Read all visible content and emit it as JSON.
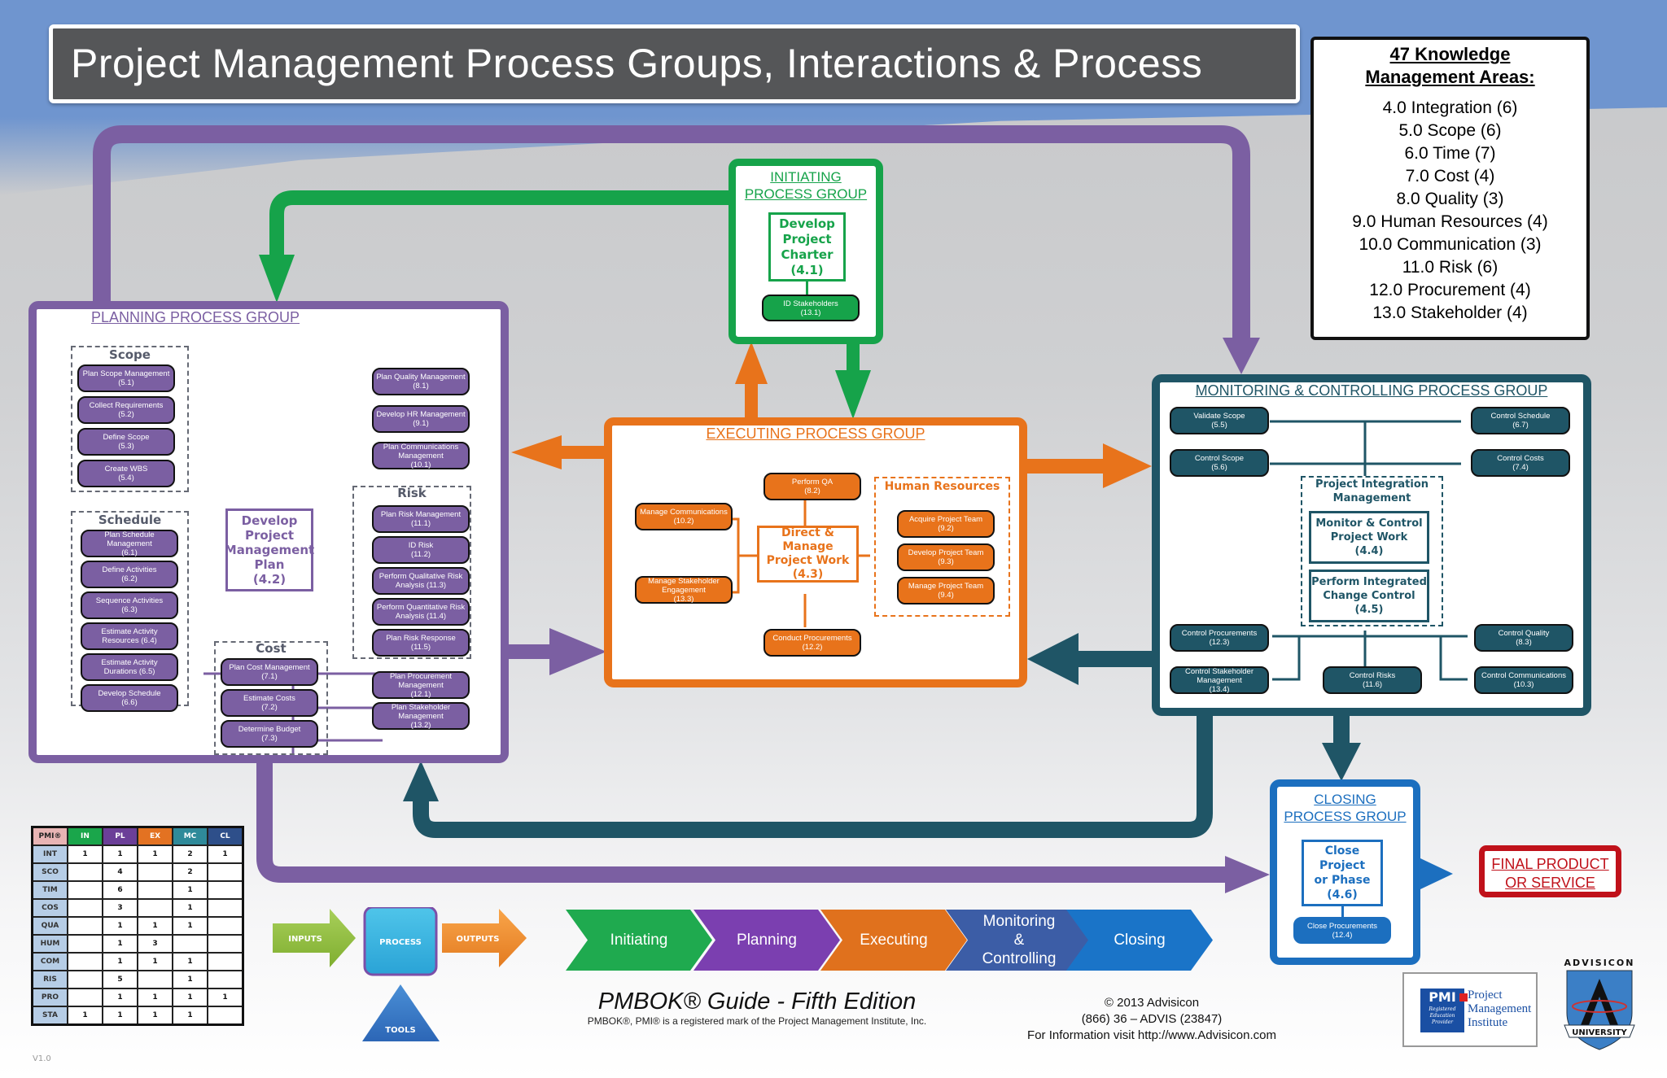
{
  "title": "Project Management Process Groups, Interactions & Process",
  "knowledge_areas": {
    "title_line1": "47 Knowledge",
    "title_line2": "Management Areas:",
    "items": [
      "4.0 Integration (6)",
      "5.0 Scope (6)",
      "6.0 Time (7)",
      "7.0 Cost (4)",
      "8.0 Quality (3)",
      "9.0 Human Resources (4)",
      "10.0 Communication (3)",
      "11.0 Risk (6)",
      "12.0 Procurement (4)",
      "13.0 Stakeholder (4)"
    ]
  },
  "colors": {
    "initiating": "#16a34a",
    "planning": "#7b5fa2",
    "executing": "#e8731b",
    "monitoring": "#1f5566",
    "closing": "#1c6fbf",
    "final": "#c0111a"
  },
  "initiating": {
    "heading_line1": "INITIATING",
    "heading_line2": "PROCESS GROUP",
    "core": "Develop\nProject\nCharter\n(4.1)",
    "processes": [
      {
        "name": "ID Stakeholders",
        "code": "(13.1)"
      }
    ]
  },
  "planning": {
    "heading": "PLANNING PROCESS GROUP",
    "core": "Develop\nProject\nManagement\nPlan\n(4.2)",
    "scope": {
      "label": "Scope",
      "processes": [
        {
          "name": "Plan Scope Management",
          "code": "(5.1)"
        },
        {
          "name": "Collect Requirements",
          "code": "(5.2)"
        },
        {
          "name": "Define Scope",
          "code": "(5.3)"
        },
        {
          "name": "Create WBS",
          "code": "(5.4)"
        }
      ]
    },
    "schedule": {
      "label": "Schedule",
      "processes": [
        {
          "name": "Plan Schedule Management",
          "code": "(6.1)"
        },
        {
          "name": "Define Activities",
          "code": "(6.2)"
        },
        {
          "name": "Sequence Activities",
          "code": "(6.3)"
        },
        {
          "name": "Estimate Activity Resources (6.4)",
          "code": ""
        },
        {
          "name": "Estimate Activity Durations (6.5)",
          "code": ""
        },
        {
          "name": "Develop Schedule",
          "code": "(6.6)"
        }
      ]
    },
    "cost": {
      "label": "Cost",
      "processes": [
        {
          "name": "Plan Cost Management",
          "code": "(7.1)"
        },
        {
          "name": "Estimate Costs",
          "code": "(7.2)"
        },
        {
          "name": "Determine Budget",
          "code": "(7.3)"
        }
      ]
    },
    "other": [
      {
        "name": "Plan Quality Management",
        "code": "(8.1)"
      },
      {
        "name": "Develop HR Management",
        "code": "(9.1)"
      },
      {
        "name": "Plan Communications Management",
        "code": "(10.1)"
      }
    ],
    "risk": {
      "label": "Risk",
      "processes": [
        {
          "name": "Plan Risk Management",
          "code": "(11.1)"
        },
        {
          "name": "ID Risk",
          "code": "(11.2)"
        },
        {
          "name": "Perform Qualitative Risk Analysis (11.3)",
          "code": ""
        },
        {
          "name": "Perform Quantitative Risk Analysis (11.4)",
          "code": ""
        },
        {
          "name": "Plan Risk Response",
          "code": "(11.5)"
        }
      ]
    },
    "procurement_stakeholder": [
      {
        "name": "Plan Procurement Management",
        "code": "(12.1)"
      },
      {
        "name": "Plan Stakeholder Management",
        "code": "(13.2)"
      }
    ]
  },
  "executing": {
    "heading": "EXECUTING PROCESS GROUP",
    "core": "Direct & Manage\nProject Work\n(4.3)",
    "top": {
      "name": "Perform QA",
      "code": "(8.2)"
    },
    "bottom": {
      "name": "Conduct Procurements",
      "code": "(12.2)"
    },
    "left": [
      {
        "name": "Manage Communications",
        "code": "(10.2)"
      },
      {
        "name": "Manage Stakeholder Engagement",
        "code": "(13.3)"
      }
    ],
    "hr": {
      "label": "Human Resources",
      "processes": [
        {
          "name": "Acquire Project Team",
          "code": "(9.2)"
        },
        {
          "name": "Develop Project Team",
          "code": "(9.3)"
        },
        {
          "name": "Manage Project Team",
          "code": "(9.4)"
        }
      ]
    }
  },
  "monitoring": {
    "heading": "MONITORING & CONTROLLING PROCESS GROUP",
    "integration_label": "Project Integration\nManagement",
    "core1": "Monitor & Control\nProject Work\n(4.4)",
    "core2": "Perform Integrated\nChange Control\n(4.5)",
    "processes": [
      {
        "name": "Validate Scope",
        "code": "(5.5)"
      },
      {
        "name": "Control Scope",
        "code": "(5.6)"
      },
      {
        "name": "Control Schedule",
        "code": "(6.7)"
      },
      {
        "name": "Control Costs",
        "code": "(7.4)"
      },
      {
        "name": "Control Procurements",
        "code": "(12.3)"
      },
      {
        "name": "Control Stakeholder Management",
        "code": "(13.4)"
      },
      {
        "name": "Control Risks",
        "code": "(11.6)"
      },
      {
        "name": "Control Quality",
        "code": "(8.3)"
      },
      {
        "name": "Control Communications",
        "code": "(10.3)"
      }
    ]
  },
  "closing": {
    "heading_line1": "CLOSING",
    "heading_line2": "PROCESS GROUP",
    "core": "Close Project\nor Phase\n(4.6)",
    "processes": [
      {
        "name": "Close Procurements",
        "code": "(12.4)"
      }
    ]
  },
  "final": {
    "line1": "FINAL PRODUCT",
    "line2": "OR SERVICE"
  },
  "pmi_table": {
    "corner": "PMI®",
    "columns": [
      {
        "label": "IN",
        "color": "#1aa64b"
      },
      {
        "label": "PL",
        "color": "#6b3f98"
      },
      {
        "label": "EX",
        "color": "#e37222"
      },
      {
        "label": "MC",
        "color": "#2f8a9a"
      },
      {
        "label": "CL",
        "color": "#2e4f8a"
      }
    ],
    "rows": [
      {
        "label": "INT",
        "values": [
          "1",
          "1",
          "1",
          "2",
          "1"
        ]
      },
      {
        "label": "SCO",
        "values": [
          "",
          "4",
          "",
          "2",
          ""
        ]
      },
      {
        "label": "TIM",
        "values": [
          "",
          "6",
          "",
          "1",
          ""
        ]
      },
      {
        "label": "COS",
        "values": [
          "",
          "3",
          "",
          "1",
          ""
        ]
      },
      {
        "label": "QUA",
        "values": [
          "",
          "1",
          "1",
          "1",
          ""
        ]
      },
      {
        "label": "HUM",
        "values": [
          "",
          "1",
          "3",
          "",
          ""
        ]
      },
      {
        "label": "COM",
        "values": [
          "",
          "1",
          "1",
          "1",
          ""
        ]
      },
      {
        "label": "RIS",
        "values": [
          "",
          "5",
          "",
          "1",
          ""
        ]
      },
      {
        "label": "PRO",
        "values": [
          "",
          "1",
          "1",
          "1",
          "1"
        ]
      },
      {
        "label": "STA",
        "values": [
          "1",
          "1",
          "1",
          "1",
          ""
        ]
      }
    ]
  },
  "ipo": {
    "inputs": "INPUTS",
    "process": "PROCESS",
    "outputs": "OUTPUTS",
    "tools": "TOOLS"
  },
  "phases": [
    {
      "label": "Initiating",
      "color": "#1faa4f"
    },
    {
      "label": "Planning",
      "color": "#7b3fb0"
    },
    {
      "label": "Executing",
      "color": "#e0711d"
    },
    {
      "label": "Monitoring\n&\nControlling",
      "color": "#3c5da6"
    },
    {
      "label": "Closing",
      "color": "#1a74c8"
    }
  ],
  "footer": {
    "pmbok": "PMBOK® Guide - Fifth Edition",
    "note": "PMBOK®, PMI® is a registered mark of the Project Management Institute, Inc.",
    "copyright": "© 2013 Advisicon",
    "phone": "(866) 36 – ADVIS (23847)",
    "info": "For Information visit http://www.Advisicon.com",
    "version": "V1.0"
  },
  "logos": {
    "pmi_text": "Project\nManagement\nInstitute",
    "pmi_badge": "PMI",
    "pmi_badge_sub": "Registered\nEducation\nProvider",
    "advisicon_top": "ADVISICON",
    "advisicon_ribbon": "UNIVERSITY"
  }
}
